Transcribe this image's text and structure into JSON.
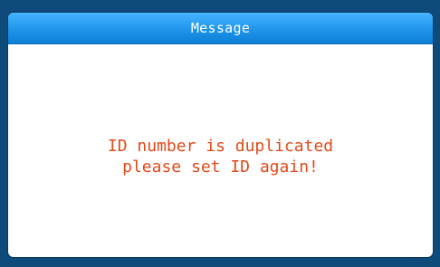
{
  "dialog": {
    "title": "Message",
    "message_lines": [
      "ID number is duplicated",
      "please set ID again!"
    ]
  },
  "colors": {
    "frame": "#0e4a7a",
    "titlebar": "#1f95ea",
    "title_text": "#ffffff",
    "message_text": "#e04a1a",
    "dialog_background": "#ffffff"
  }
}
